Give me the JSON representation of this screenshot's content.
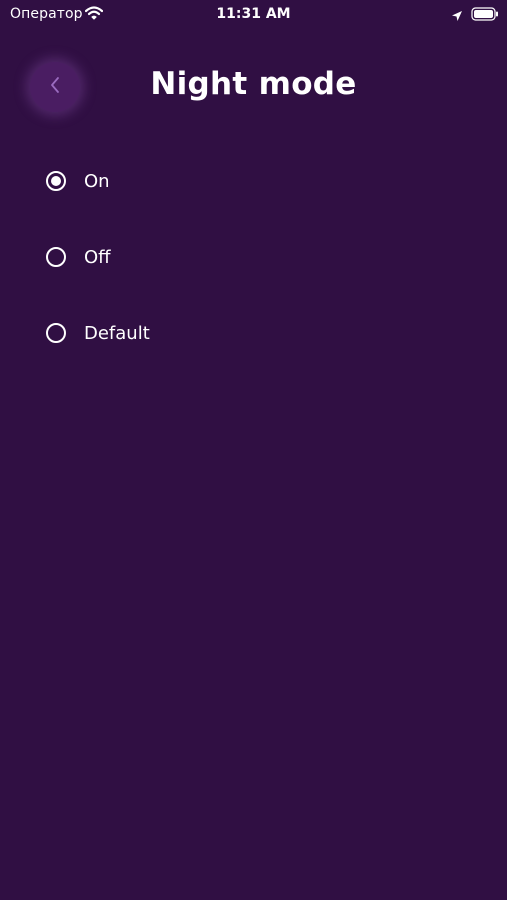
{
  "status_bar": {
    "carrier": "Оператор",
    "time": "11:31 AM"
  },
  "header": {
    "title": "Night mode",
    "back_icon": "chevron-left-icon"
  },
  "options": [
    {
      "label": "On",
      "selected": true
    },
    {
      "label": "Off",
      "selected": false
    },
    {
      "label": "Default",
      "selected": false
    }
  ],
  "colors": {
    "background": "#300f43",
    "back_button": "#4a1d62",
    "back_chevron": "#9b6cc0",
    "text": "#ffffff"
  }
}
